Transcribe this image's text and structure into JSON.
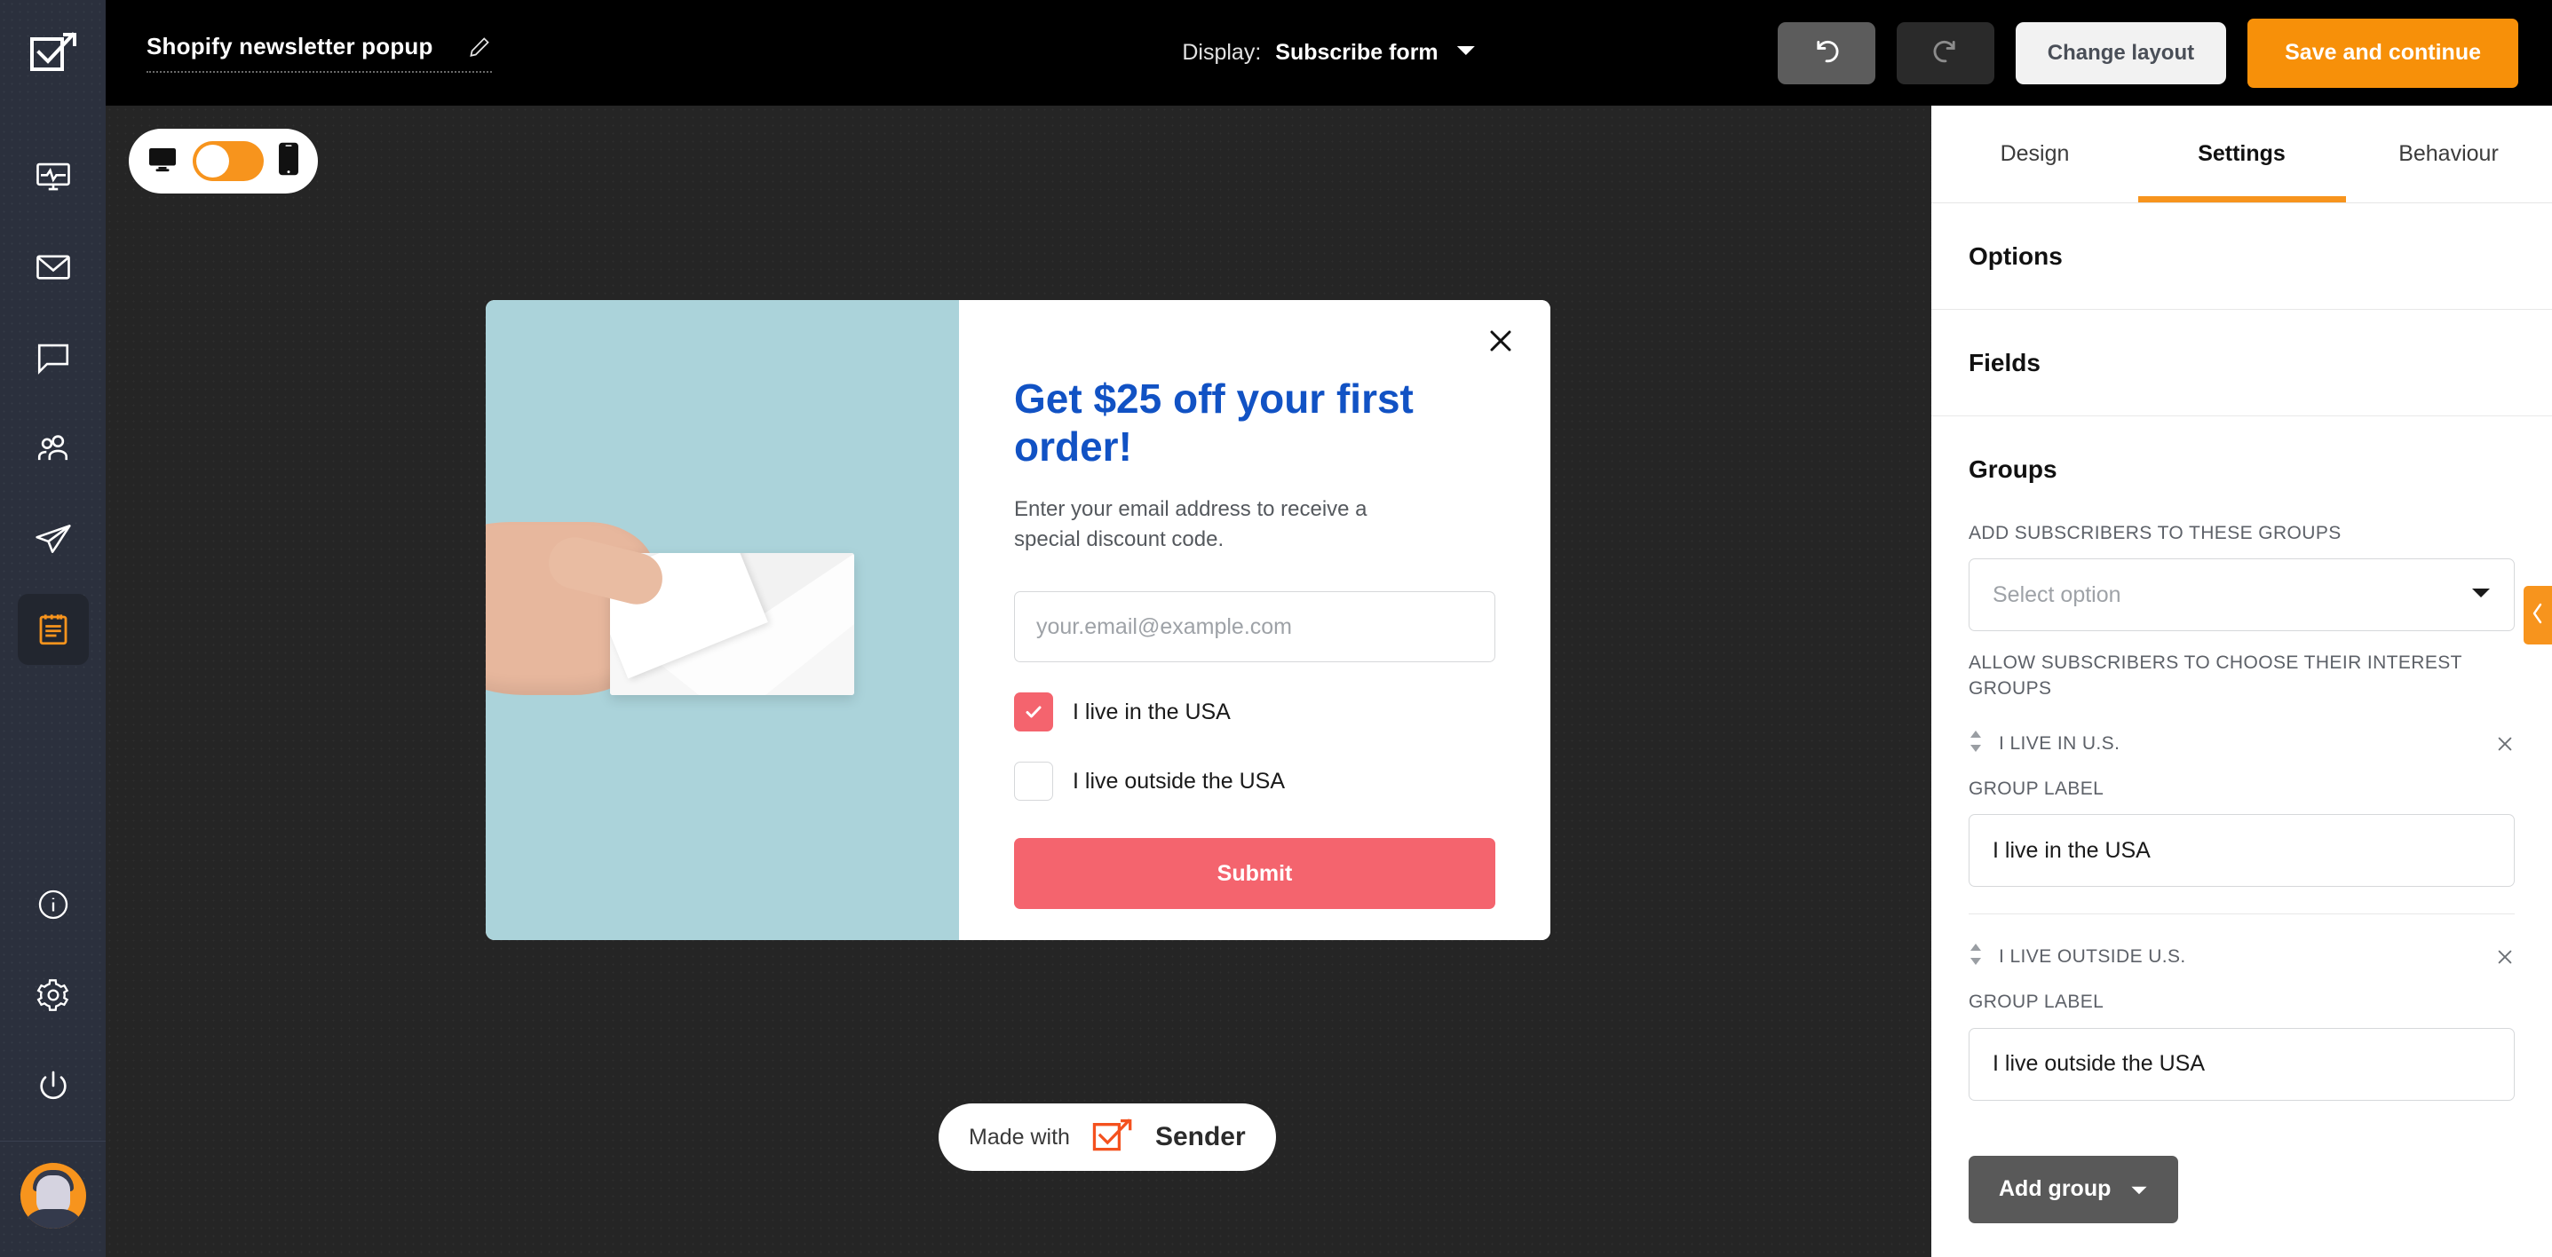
{
  "topbar": {
    "doc_title": "Shopify newsletter popup",
    "edit_icon": "pencil-icon",
    "display_label": "Display:",
    "display_value": "Subscribe form",
    "display_caret_icon": "chevron-down-icon",
    "undo_icon": "undo-icon",
    "redo_icon": "redo-icon",
    "change_layout_label": "Change layout",
    "save_continue_label": "Save and continue"
  },
  "sidebar": {
    "logo_icon": "sender-checkmark-logo",
    "items": [
      {
        "icon": "dashboard-monitor-icon",
        "active": false
      },
      {
        "icon": "envelope-icon",
        "active": false
      },
      {
        "icon": "chat-bubble-icon",
        "active": false
      },
      {
        "icon": "audience-people-icon",
        "active": false
      },
      {
        "icon": "paper-plane-icon",
        "active": false
      },
      {
        "icon": "forms-clipboard-icon",
        "active": true
      }
    ],
    "bottom_items": [
      {
        "icon": "info-circle-icon"
      },
      {
        "icon": "gear-icon"
      },
      {
        "icon": "power-icon"
      }
    ],
    "avatar_icon": "user-avatar"
  },
  "canvas": {
    "device_toggle": {
      "desktop_icon": "desktop-monitor-icon",
      "mobile_icon": "mobile-phone-icon",
      "switch_state": "desktop",
      "accent": "#f7941d"
    },
    "popup": {
      "close_icon": "close-x-icon",
      "image_alt": "hand-holding-white-envelope-on-teal-background",
      "image_bg_color": "#abd3da",
      "heading": "Get $25 off your first order!",
      "heading_color": "#1152c4",
      "subtext": "Enter your email address to receive a special discount code.",
      "email_placeholder": "your.email@example.com",
      "email_value": "",
      "checkboxes": [
        {
          "label": "I live in the USA",
          "checked": true
        },
        {
          "label": "I live outside the USA",
          "checked": false
        }
      ],
      "checkbox_accent": "#f4646e",
      "submit_label": "Submit",
      "submit_color": "#f4646e"
    },
    "badge": {
      "made_with_text": "Made with",
      "brand_name": "Sender",
      "brand_icon": "sender-checkmark-logo"
    }
  },
  "right_panel": {
    "tabs": [
      {
        "label": "Design",
        "active": false
      },
      {
        "label": "Settings",
        "active": true
      },
      {
        "label": "Behaviour",
        "active": false
      }
    ],
    "tab_accent": "#f7941d",
    "sections": [
      {
        "title": "Options"
      },
      {
        "title": "Fields"
      }
    ],
    "groups": {
      "title": "Groups",
      "add_subscribers_label": "ADD SUBSCRIBERS TO THESE GROUPS",
      "select_placeholder": "Select option",
      "select_caret_icon": "chevron-down-icon",
      "allow_choose_label": "ALLOW SUBSCRIBERS TO CHOOSE THEIR INTEREST GROUPS",
      "items": [
        {
          "name": "I LIVE IN U.S.",
          "drag_icon": "drag-handle-icon",
          "remove_icon": "close-x-icon",
          "label_caption": "GROUP LABEL",
          "label_value": "I live in the USA"
        },
        {
          "name": "I LIVE OUTSIDE U.S.",
          "drag_icon": "drag-handle-icon",
          "remove_icon": "close-x-icon",
          "label_caption": "GROUP LABEL",
          "label_value": "I live outside the USA"
        }
      ],
      "add_group_label": "Add group",
      "add_group_caret_icon": "chevron-down-icon"
    },
    "collapse_icon": "chevron-left-icon"
  }
}
